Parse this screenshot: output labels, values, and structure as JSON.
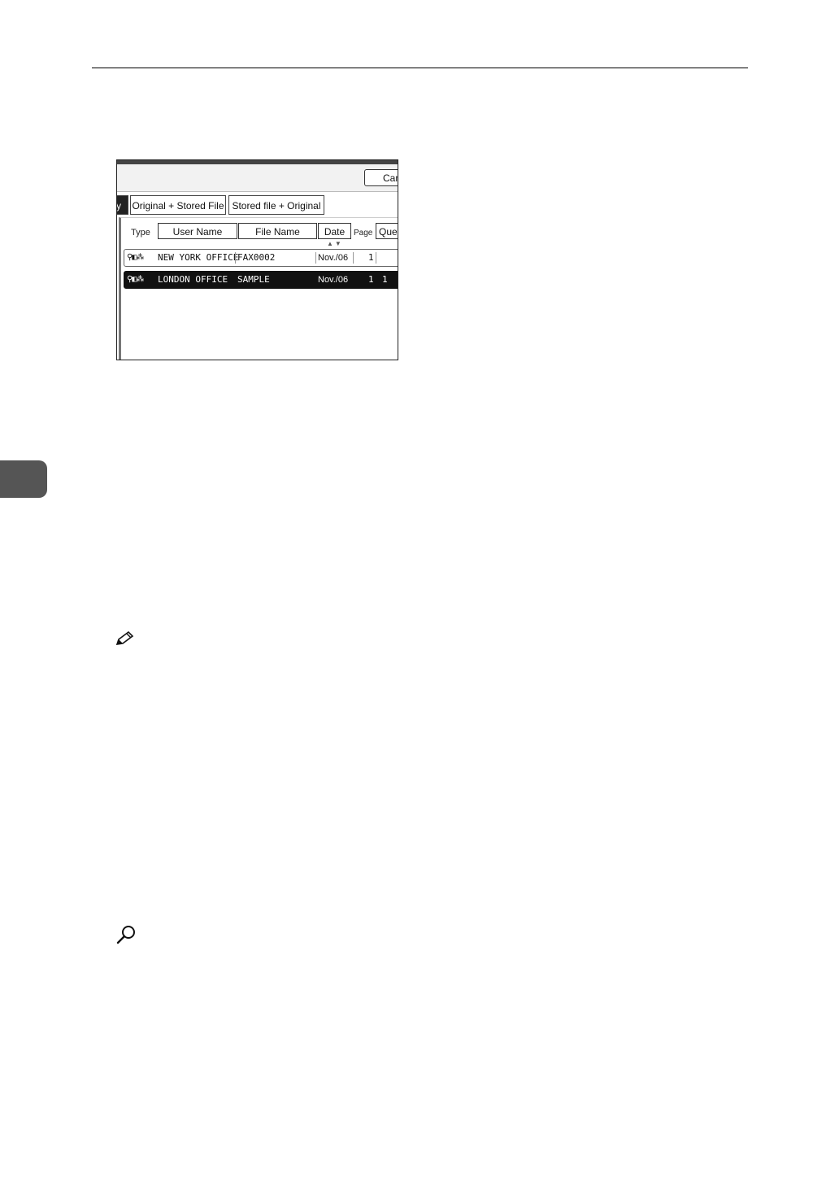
{
  "panel": {
    "cancel_label": "Can",
    "tabs": [
      "y",
      "Original + Stored File",
      "Stored file + Original"
    ],
    "columns": {
      "type": "Type",
      "user_name": "User Name",
      "file_name": "File Name",
      "date": "Date",
      "page": "Page",
      "queue": "Queu"
    },
    "sort_indicator": "▲▼",
    "rows": [
      {
        "icons": "⚲◧⁂",
        "user": "NEW YORK OFFICE",
        "file": "FAX0002",
        "date": "Nov./06",
        "page": "1",
        "queue": "",
        "selected": false
      },
      {
        "icons": "⚲◧⁂",
        "user": "LONDON OFFICE",
        "file": "SAMPLE",
        "date": "Nov./06",
        "page": "1",
        "queue": "1",
        "selected": true
      }
    ]
  },
  "icons": {
    "note": "pencil-note-icon",
    "reference": "magnifier-reference-icon"
  }
}
